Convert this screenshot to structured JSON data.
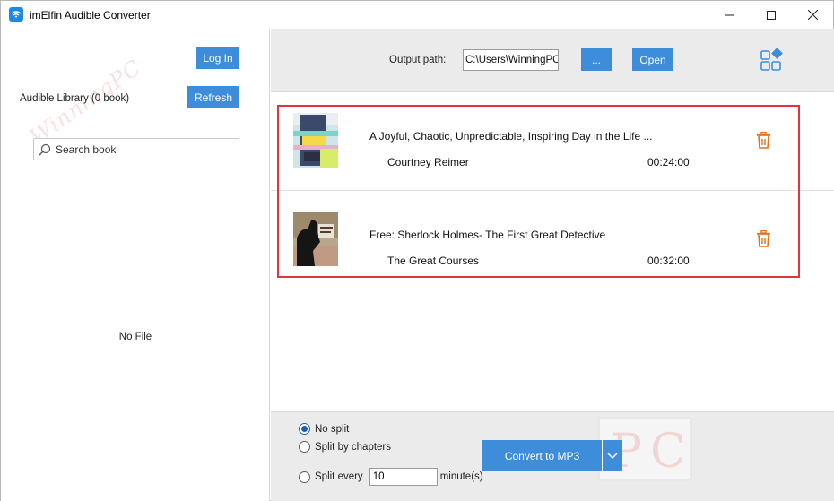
{
  "window": {
    "title": "imElfin Audible Converter",
    "accent_color": "#3d8ddb",
    "highlight_color": "#e2343f"
  },
  "sidebar": {
    "login_label": "Log In",
    "library_label": "Audible Library (0 book)",
    "refresh_label": "Refresh",
    "search_placeholder": "Search book",
    "empty_label": "No File"
  },
  "header": {
    "output_label": "Output path:",
    "output_path": "C:\\Users\\WinningPC\\j",
    "browse_label": "...",
    "open_label": "Open"
  },
  "books": [
    {
      "title": "A Joyful, Chaotic, Unpredictable, Inspiring Day in the Life ...",
      "author": "Courtney Reimer",
      "duration": "00:24:00"
    },
    {
      "title": "Free: Sherlock Holmes- The First Great Detective",
      "author": "The Great Courses",
      "duration": "00:32:00"
    }
  ],
  "options": {
    "no_split_label": "No split",
    "split_chapters_label": "Split by chapters",
    "split_every_label": "Split every",
    "split_every_value": "10",
    "minutes_label": "minute(s)",
    "selected": "no_split"
  },
  "convert": {
    "label": "Convert to MP3"
  },
  "watermark": {
    "text": "WinningPC",
    "pc_letters": [
      "P",
      "C"
    ]
  }
}
